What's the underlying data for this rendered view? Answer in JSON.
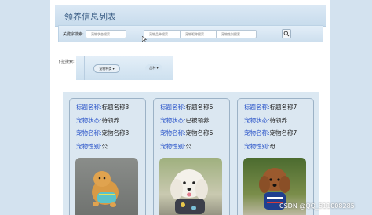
{
  "header": {
    "title": "领养信息列表"
  },
  "search": {
    "label": "关键字搜索:",
    "fields": [
      "宠物状态搜索",
      "宠物品种搜索",
      "宠物昵称搜索",
      "宠物性别搜索"
    ],
    "button_icon": "search-icon"
  },
  "filter": {
    "label": "下拉搜索:",
    "options": [
      "宠物种类",
      "品种"
    ]
  },
  "cards": [
    {
      "title_key": "标题名称:",
      "title": "标题名称3",
      "status_key": "宠物状态:",
      "status": "待领养",
      "name_key": "宠物名称:",
      "name": "宠物名称3",
      "gender_key": "宠物性别:",
      "gender": "公"
    },
    {
      "title_key": "标题名称:",
      "title": "标题名称6",
      "status_key": "宠物状态:",
      "status": "已被领养",
      "name_key": "宠物名称:",
      "name": "宠物名称6",
      "gender_key": "宠物性别:",
      "gender": "公"
    },
    {
      "title_key": "标题名称:",
      "title": "标题名称7",
      "status_key": "宠物状态:",
      "status": "待领养",
      "name_key": "宠物名称:",
      "name": "宠物名称7",
      "gender_key": "宠物性别:",
      "gender": "母"
    }
  ],
  "watermark": "CSDN @QQ_511008285"
}
